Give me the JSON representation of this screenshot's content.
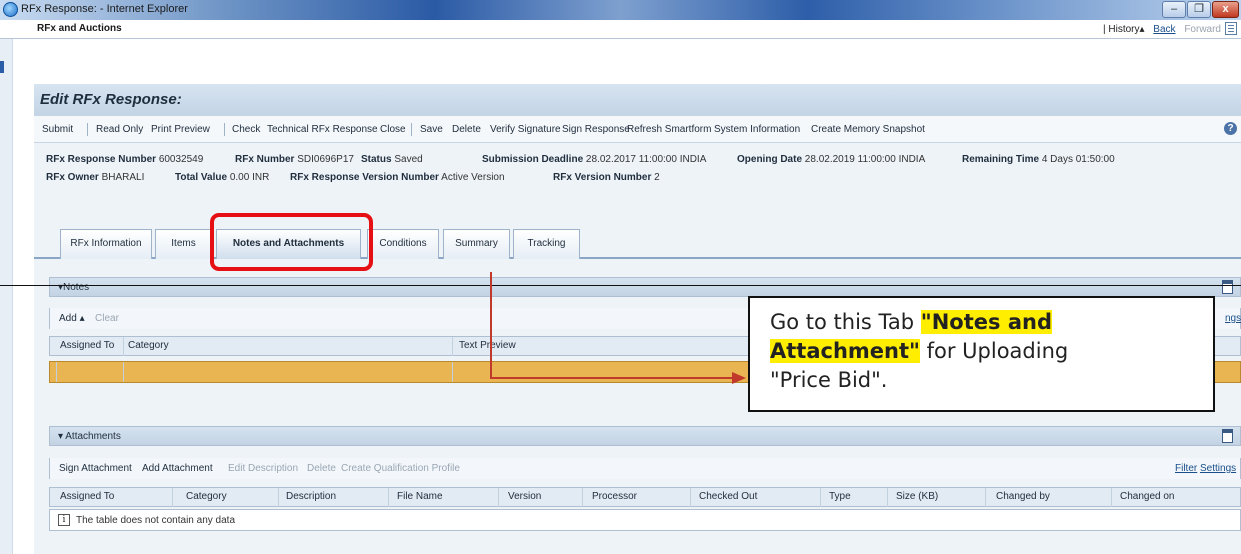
{
  "window": {
    "title": "RFx Response: - Internet Explorer",
    "min_label": "–",
    "max_label": "❐",
    "close_label": "x"
  },
  "nav": {
    "app": "RFx and Auctions",
    "history": "| History▴",
    "back": "Back",
    "forward": "Forward"
  },
  "page_title": "Edit RFx Response:",
  "toolbar": {
    "submit": "Submit",
    "read_only": "Read Only",
    "print_preview": "Print Preview",
    "check": "Check",
    "technical": "Technical RFx Response",
    "close": "Close",
    "save": "Save",
    "delete": "Delete",
    "verify": "Verify Signature",
    "sign": "Sign Response",
    "refresh": "Refresh Smartform",
    "sysinfo": "System Information",
    "memory": "Create Memory Snapshot",
    "help": "?"
  },
  "header": {
    "response_number_label": "RFx Response Number",
    "response_number": "60032549",
    "rfx_number_label": "RFx Number",
    "rfx_number": "SDI0696P17",
    "status_label": "Status",
    "status": "Saved",
    "deadline_label": "Submission Deadline",
    "deadline": "28.02.2017 11:00:00 INDIA",
    "opening_label": "Opening Date",
    "opening": "28.02.2019 11:00:00 INDIA",
    "remaining_label": "Remaining Time",
    "remaining": "4 Days 01:50:00",
    "owner_label": "RFx Owner",
    "owner": "BHARALI",
    "total_label": "Total Value",
    "total": "0.00 INR",
    "version_label": "RFx Response Version Number",
    "version": "Active Version",
    "rfx_version_label": "RFx Version Number",
    "rfx_version": "2"
  },
  "tabs": [
    "RFx Information",
    "Items",
    "Notes and Attachments",
    "Conditions",
    "Summary",
    "Tracking"
  ],
  "notes": {
    "title": "▾Notes",
    "add": "Add ▴",
    "clear": "Clear",
    "right_link": "ngs",
    "columns": [
      "Assigned To",
      "Category",
      "Text Preview"
    ]
  },
  "attachments": {
    "title": "▾ Attachments",
    "actions": [
      "Sign Attachment",
      "Add Attachment"
    ],
    "disabled_actions": [
      "Edit Description",
      "Delete",
      "Create Qualification Profile"
    ],
    "filter": "Filter",
    "settings": "Settings",
    "columns": [
      "Assigned To",
      "Category",
      "Description",
      "File Name",
      "Version",
      "Processor",
      "Checked Out",
      "Type",
      "Size (KB)",
      "Changed by",
      "Changed on"
    ],
    "empty": "The table does not contain any data",
    "info_icon": "i"
  },
  "callout": {
    "line1": "Go to this Tab ",
    "hl1": "\"Notes and",
    "hl2": "Attachment\"",
    "line2": " for Uploading",
    "line3": "\"Price Bid\"."
  },
  "colors": {
    "highlight": "#e60f14",
    "arrow": "#c0392b",
    "row_selected": "#e9b552",
    "marker": "#ffee00"
  }
}
